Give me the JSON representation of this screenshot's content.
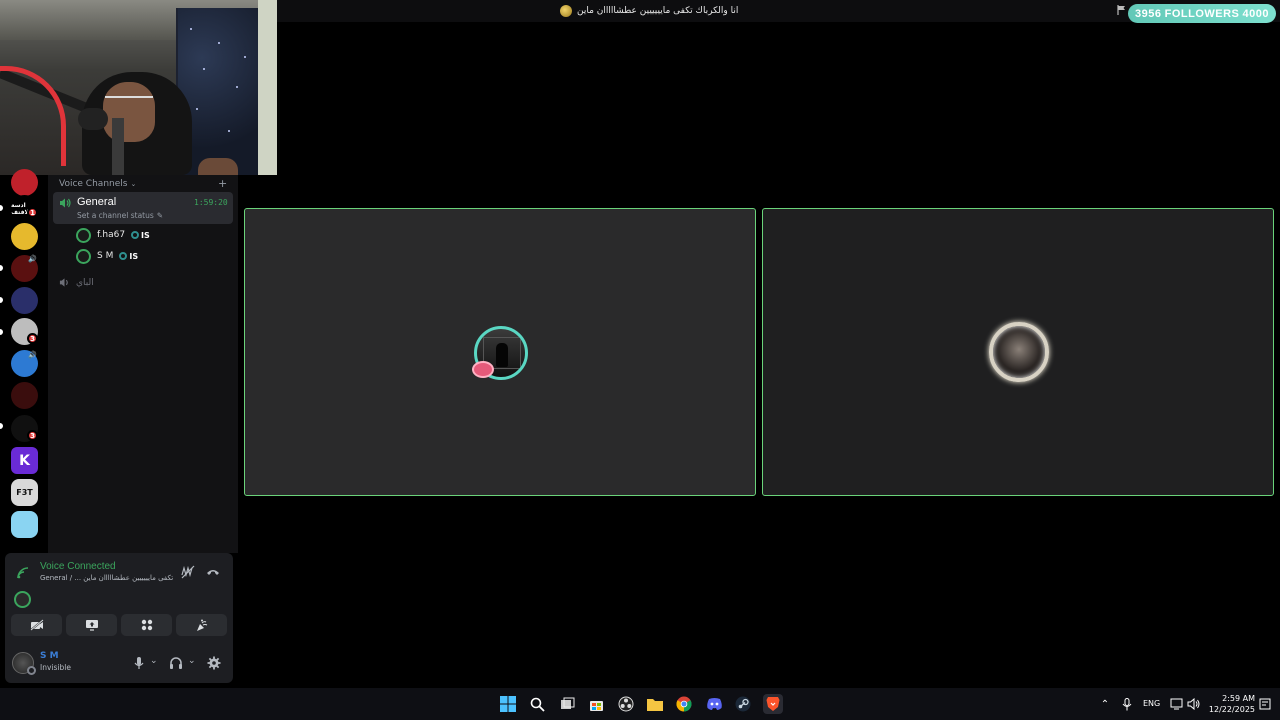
{
  "topbar": {
    "stream_title": "انا والكرباك تكفى مايييييين عطشااااان ماين",
    "followers_current": "3956",
    "followers_label": "FOLLOWERS",
    "followers_goal": "4000",
    "accent_color": "#6fd6c4"
  },
  "servers": [
    {
      "label": "",
      "color": "#c0212b",
      "badge": ""
    },
    {
      "label": "ادسة الافتف",
      "color": "#000000",
      "badge": "1"
    },
    {
      "label": "",
      "color": "#e6b92d",
      "badge": ""
    },
    {
      "label": "",
      "color": "#5a1010",
      "badge": ""
    },
    {
      "label": "",
      "color": "#2a2f6a",
      "badge": ""
    },
    {
      "label": "",
      "color": "#bdbdbd",
      "badge": "3"
    },
    {
      "label": "",
      "color": "#2d7ad3",
      "badge": ""
    },
    {
      "label": "",
      "color": "#3a0d0d",
      "badge": ""
    },
    {
      "label": "",
      "color": "#101010",
      "badge": "3"
    },
    {
      "label": "",
      "color": "#6a2bd6",
      "badge": ""
    },
    {
      "label": "F3T",
      "color": "#d9d9d9",
      "badge": ""
    },
    {
      "label": "",
      "color": "#8ad4f2",
      "badge": ""
    }
  ],
  "sidebar": {
    "section_label": "Voice Channels",
    "general": {
      "name": "General",
      "timer": "1:59:20",
      "status_placeholder": "Set a channel status"
    },
    "members": [
      {
        "name": "f.ha67",
        "tag": "IS"
      },
      {
        "name": "S M",
        "tag": "IS"
      }
    ],
    "other_channel": "الباي"
  },
  "voice_panel": {
    "title": "Voice Connected",
    "subtitle": "General / ... تكفى مايييييين عطشااااان ماين",
    "user_name": "S M",
    "user_status": "Invisible"
  },
  "taskbar": {
    "language": "ENG",
    "time": "2:59 AM",
    "date": "12/22/2025"
  }
}
